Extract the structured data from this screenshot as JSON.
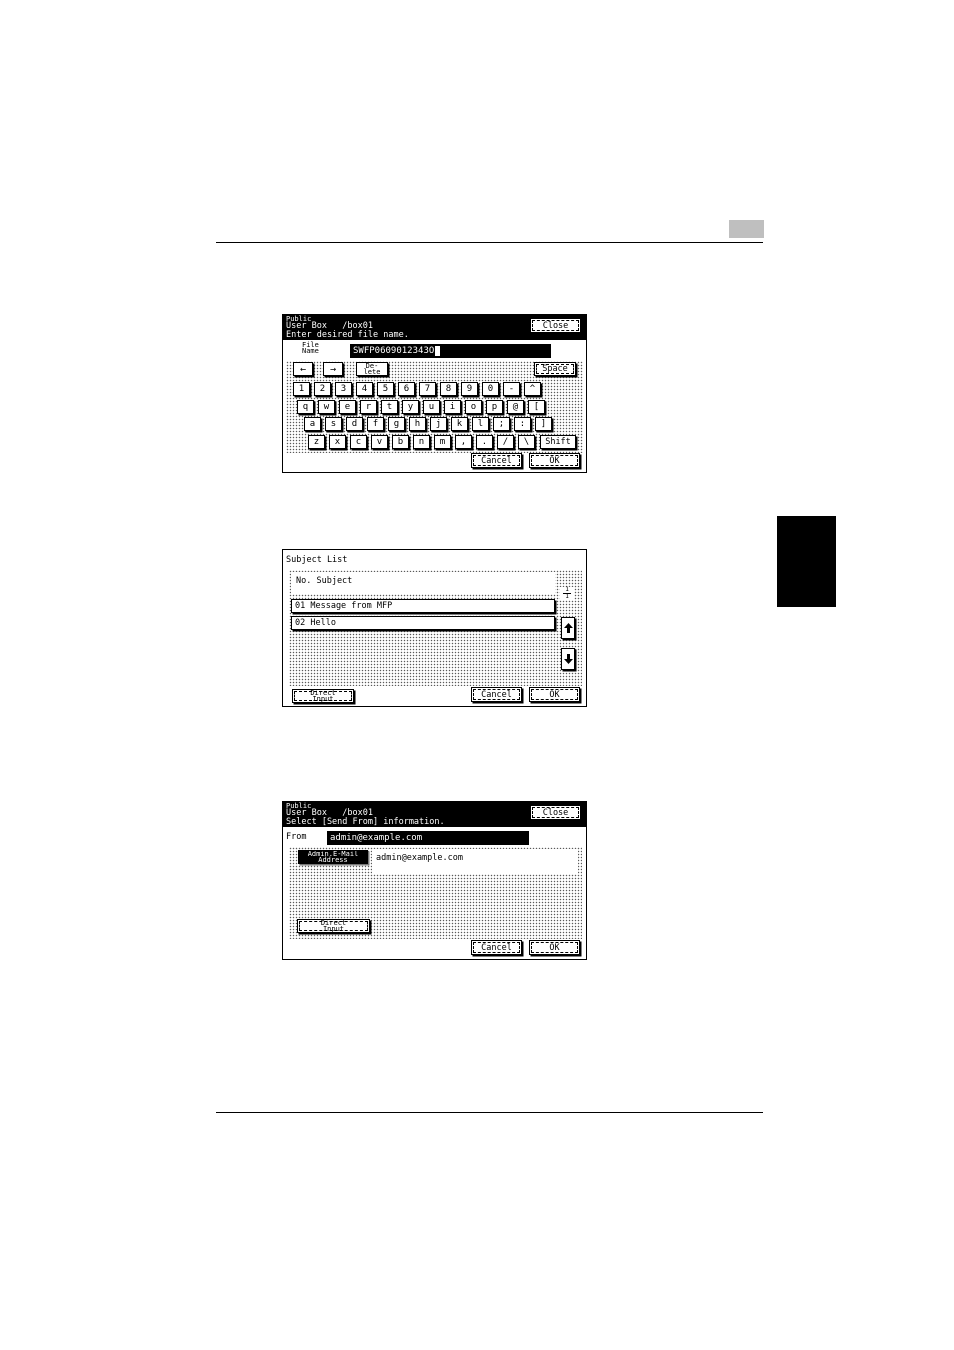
{
  "panel1": {
    "title_line1": "Public",
    "title_line2": "User Box   /box01",
    "title_line3": "Enter desired file name.",
    "close_label": "Close",
    "file_name_label_line1": "File",
    "file_name_label_line2": "Name",
    "file_name_value": "SWFP0609012343O",
    "left_arrow": "←",
    "right_arrow": "→",
    "delete_line1": "De-",
    "delete_line2": "lete",
    "space_label": "Space",
    "shift_label": "Shift",
    "cancel_label": "Cancel",
    "ok_label": "OK",
    "row1": [
      "1",
      "2",
      "3",
      "4",
      "5",
      "6",
      "7",
      "8",
      "9",
      "0",
      "-",
      "^"
    ],
    "row2": [
      "q",
      "w",
      "e",
      "r",
      "t",
      "y",
      "u",
      "i",
      "o",
      "p",
      "@",
      "["
    ],
    "row3": [
      "a",
      "s",
      "d",
      "f",
      "g",
      "h",
      "j",
      "k",
      "l",
      ";",
      ":",
      "]"
    ],
    "row4": [
      "z",
      "x",
      "c",
      "v",
      "b",
      "n",
      "m",
      ",",
      ".",
      "/",
      "\\"
    ]
  },
  "panel2": {
    "title": "Subject List",
    "header": "No. Subject",
    "items": [
      "01 Message from MFP",
      "02 Hello"
    ],
    "page_current": "1",
    "page_total": "1",
    "direct_input_line1": "Direct",
    "direct_input_line2": "Input",
    "cancel_label": "Cancel",
    "ok_label": "OK"
  },
  "panel3": {
    "title_line1": "Public",
    "title_line2": "User Box   /box01",
    "title_line3": "Select [Send From] information.",
    "close_label": "Close",
    "from_label": "From",
    "from_value": "admin@example.com",
    "admin_btn_line1": "Admin.E-Mail",
    "admin_btn_line2": "Address",
    "admin_email": "admin@example.com",
    "direct_input_line1": "Direct",
    "direct_input_line2": "Input",
    "cancel_label": "Cancel",
    "ok_label": "OK"
  }
}
